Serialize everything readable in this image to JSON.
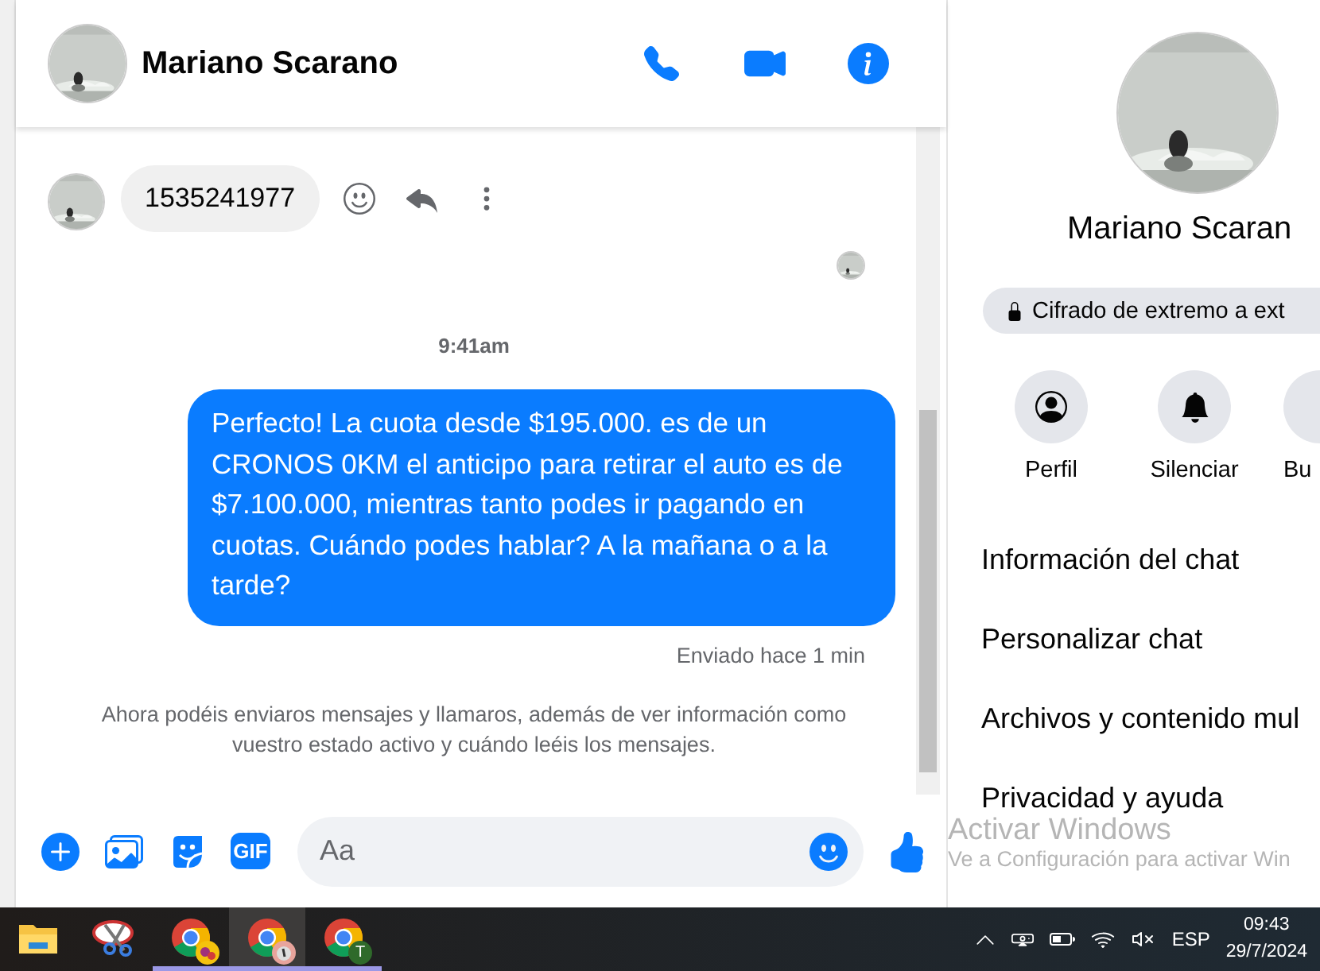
{
  "conversation_header": {
    "name": "Mariano Scarano"
  },
  "messages": [
    {
      "kind": "incoming",
      "text": "1535241977"
    },
    {
      "kind": "seen"
    },
    {
      "kind": "timestamp",
      "text": "9:41am"
    },
    {
      "kind": "outgoing",
      "text": "Perfecto! La cuota desde $195.000. es de un CRONOS 0KM el anticipo para retirar el auto es de $7.100.000, mientras tanto podes ir pagando en cuotas. Cuándo podes hablar? A la mañana o a la tarde?"
    },
    {
      "kind": "status",
      "text": "Enviado hace 1 min"
    },
    {
      "kind": "notice",
      "text": "Ahora podéis enviaros mensajes y llamaros, además de ver información como vuestro estado activo y cuándo leéis los mensajes."
    }
  ],
  "composer": {
    "gif_label": "GIF",
    "placeholder": "Aa"
  },
  "profile": {
    "name": "Mariano Scaran",
    "encryption": "Cifrado de extremo a ext",
    "actions": [
      {
        "kind": "profile",
        "label": "Perfil"
      },
      {
        "kind": "mute",
        "label": "Silenciar"
      },
      {
        "kind": "search",
        "label": "Bu"
      }
    ],
    "menu": [
      "Información del chat",
      "Personalizar chat",
      "Archivos y contenido mul",
      "Privacidad y ayuda"
    ]
  },
  "activation_notice": {
    "title": "Activar Windows",
    "text": "Ve a Configuración para activar Win"
  },
  "taskbar": {
    "apps": [
      {
        "kind": "folder",
        "selected": false,
        "running": false
      },
      {
        "kind": "snipping",
        "selected": false,
        "running": false
      },
      {
        "kind": "chrome",
        "badge": {
          "kind": "dots"
        },
        "selected": false,
        "running": true
      },
      {
        "kind": "chrome",
        "badge": {
          "kind": "clock"
        },
        "selected": true,
        "running": true
      },
      {
        "kind": "chrome",
        "badge": {
          "kind": "letter",
          "text": "T"
        },
        "selected": false,
        "running": true
      }
    ],
    "tray": {
      "language": "ESP",
      "time": "09:43",
      "date": "29/7/2024"
    }
  }
}
